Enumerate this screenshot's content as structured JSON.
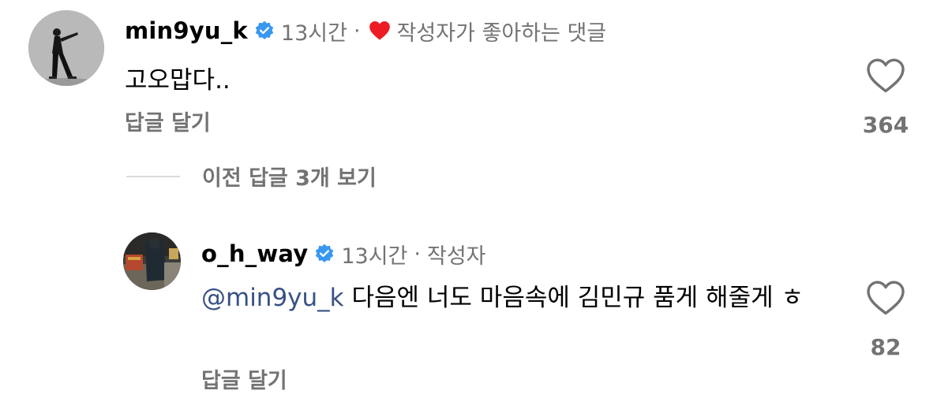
{
  "comments": [
    {
      "username": "min9yu_k",
      "time": "13시간",
      "separator": "·",
      "author_liked_label": "작성자가 좋아하는 댓글",
      "text": "고오맙다..",
      "reply_label": "답글 달기",
      "like_count": "364"
    }
  ],
  "view_previous_replies": "이전 답글 3개 보기",
  "replies": [
    {
      "username": "o_h_way",
      "time": "13시간",
      "separator": "·",
      "author_badge": "작성자",
      "mention": "@min9yu_k",
      "text": " 다음엔 너도 마음속에 김민규 품게 해줄게 ㅎ",
      "reply_label": "답글 달기",
      "like_count": "82"
    }
  ],
  "colors": {
    "verified_badge": "#3897f0",
    "heart_red": "#ed1c24",
    "secondary_text": "#737373",
    "mention": "#385185"
  },
  "icons": {
    "verified": "verified-badge-icon",
    "author_liked": "heart-filled-icon",
    "like": "heart-outline-icon"
  }
}
